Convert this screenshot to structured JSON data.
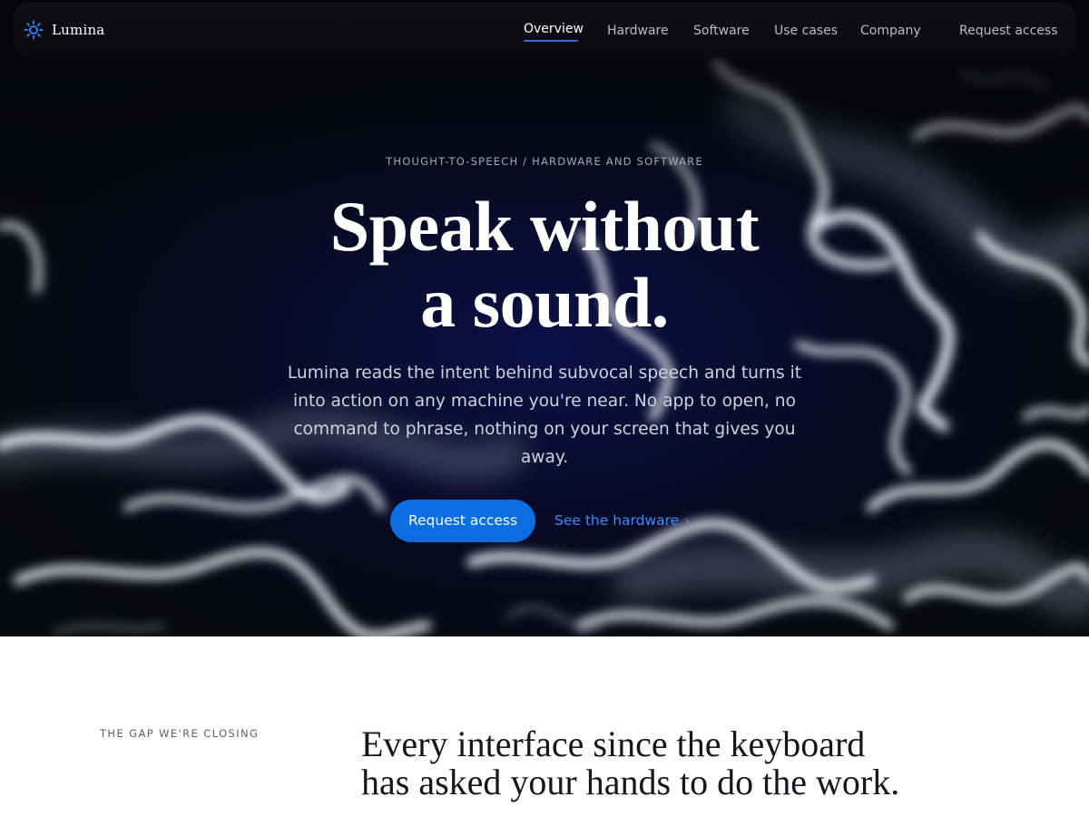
{
  "brand": {
    "name": "Lumina",
    "icon": "sun-icon"
  },
  "nav": {
    "links": [
      "Overview",
      "Hardware",
      "Software",
      "Use cases",
      "Company"
    ],
    "active": "Overview",
    "cta": "Request access"
  },
  "hero": {
    "eyebrow": "THOUGHT-TO-SPEECH / HARDWARE AND SOFTWARE",
    "headline_line1": "Speak without",
    "headline_line2": "a sound.",
    "lede": "Lumina reads the intent behind subvocal speech and turns it into action on any machine you're near. No app to open, no command to phrase, nothing on your screen that gives you away.",
    "primary_cta": "Request access",
    "secondary_cta": "See the hardware",
    "secondary_icon": "chevron-right-icon"
  },
  "section": {
    "eyebrow": "THE GAP WE'RE CLOSING",
    "title_line1": "Every interface since the keyboard",
    "title_line2": "has asked your hands to do the work."
  },
  "colors": {
    "accent": "#0a6ee0",
    "link": "#3a8df4",
    "hero_bg": "#07080f",
    "page_bg": "#ffffff"
  }
}
